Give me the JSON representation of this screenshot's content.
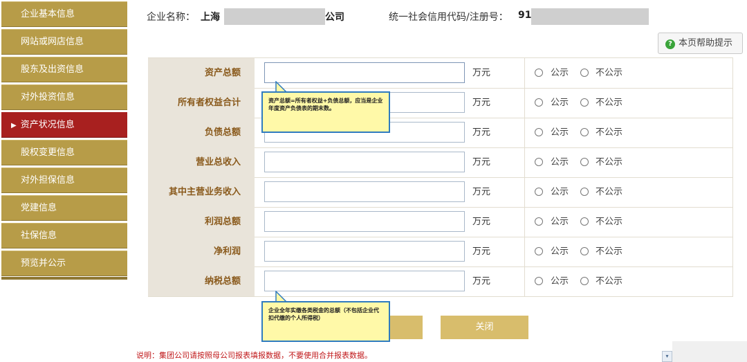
{
  "sidebar": {
    "items": [
      {
        "label": "企业基本信息",
        "active": false
      },
      {
        "label": "网站或网店信息",
        "active": false
      },
      {
        "label": "股东及出资信息",
        "active": false
      },
      {
        "label": "对外投资信息",
        "active": false
      },
      {
        "label": "资产状况信息",
        "active": true
      },
      {
        "label": "股权变更信息",
        "active": false
      },
      {
        "label": "对外担保信息",
        "active": false
      },
      {
        "label": "党建信息",
        "active": false
      },
      {
        "label": "社保信息",
        "active": false
      },
      {
        "label": "预览并公示",
        "active": false
      }
    ],
    "active_marker": "▶"
  },
  "header": {
    "company_label": "企业名称：",
    "company_prefix": "上海",
    "company_suffix": "公司",
    "credit_label": "统一社会信用代码/注册号：",
    "credit_prefix": "91"
  },
  "help_button": {
    "icon": "question-circle-icon",
    "label": "本页帮助提示"
  },
  "form": {
    "unit": "万元",
    "public_label": "公示",
    "private_label": "不公示",
    "rows": [
      {
        "label": "资产总额",
        "value": ""
      },
      {
        "label": "所有者权益合计",
        "value": ""
      },
      {
        "label": "负债总额",
        "value": ""
      },
      {
        "label": "营业总收入",
        "value": ""
      },
      {
        "label": "其中主营业务收入",
        "value": ""
      },
      {
        "label": "利润总额",
        "value": ""
      },
      {
        "label": "净利润",
        "value": ""
      },
      {
        "label": "纳税总额",
        "value": ""
      }
    ]
  },
  "tooltips": {
    "assets": "资产总额=所有者权益+负债总额，应当是企业年度资产负债表的期末数。",
    "tax": "企业全年实缴各类税金的总额（不包括企业代扣代缴的个人所得税）"
  },
  "buttons": {
    "save_label": "",
    "close_label": "关闭"
  },
  "note": "说明：集团公司请按照母公司报表填报数据，不要使用合并报表数据。",
  "scroll_arrow": "▾",
  "colors": {
    "sidebar": "#b79c48",
    "sidebar_active": "#a8201f",
    "button": "#d8bd6c",
    "label_text": "#8a5a1c",
    "note": "#c0181a"
  }
}
